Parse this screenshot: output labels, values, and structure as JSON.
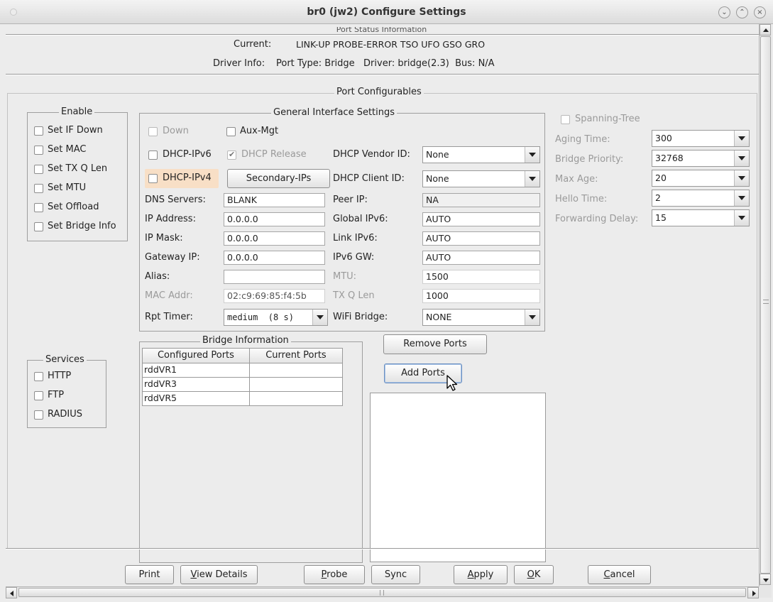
{
  "window": {
    "title": "br0  (jw2) Configure Settings"
  },
  "port_status": {
    "section_title": "Port Status Information",
    "current_label": "Current:",
    "current_value": "LINK-UP PROBE-ERROR TSO UFO GSO GRO",
    "driver_label": "Driver Info:",
    "driver_value": "Port Type: Bridge   Driver: bridge(2.3)  Bus: N/A"
  },
  "port_configurables": {
    "title": "Port Configurables"
  },
  "enable": {
    "title": "Enable",
    "items": [
      "Set IF Down",
      "Set MAC",
      "Set TX Q Len",
      "Set MTU",
      "Set Offload",
      "Set Bridge Info"
    ]
  },
  "services": {
    "title": "Services",
    "items": [
      "HTTP",
      "FTP",
      "RADIUS"
    ]
  },
  "general": {
    "title": "General Interface Settings",
    "down_label": "Down",
    "aux_mgt_label": "Aux-Mgt",
    "dhcp_ipv6_label": "DHCP-IPv6",
    "dhcp_release_label": "DHCP Release",
    "dhcp_vendor_label": "DHCP Vendor ID:",
    "dhcp_vendor_value": "None",
    "dhcp_ipv4_label": "DHCP-IPv4",
    "secondary_ips_label": "Secondary-IPs",
    "dhcp_client_label": "DHCP Client ID:",
    "dhcp_client_value": "None",
    "dns_label": "DNS Servers:",
    "dns_value": "BLANK",
    "peer_ip_label": "Peer IP:",
    "peer_ip_value": "NA",
    "ip_address_label": "IP Address:",
    "ip_address_value": "0.0.0.0",
    "global_ipv6_label": "Global IPv6:",
    "global_ipv6_value": "AUTO",
    "ip_mask_label": "IP Mask:",
    "ip_mask_value": "0.0.0.0",
    "link_ipv6_label": "Link IPv6:",
    "link_ipv6_value": "AUTO",
    "gateway_label": "Gateway IP:",
    "gateway_value": "0.0.0.0",
    "ipv6_gw_label": "IPv6 GW:",
    "ipv6_gw_value": "AUTO",
    "alias_label": "Alias:",
    "alias_value": "",
    "mtu_label": "MTU:",
    "mtu_value": "1500",
    "mac_label": "MAC Addr:",
    "mac_value": "02:c9:69:85:f4:5b",
    "txq_label": "TX Q Len",
    "txq_value": "1000",
    "rpt_timer_label": "Rpt Timer:",
    "rpt_timer_value": "medium  (8 s)",
    "wifi_bridge_label": "WiFi Bridge:",
    "wifi_bridge_value": "NONE"
  },
  "stp": {
    "spanning_tree_label": "Spanning-Tree",
    "aging_label": "Aging Time:",
    "aging_value": "300",
    "priority_label": "Bridge Priority:",
    "priority_value": "32768",
    "max_age_label": "Max Age:",
    "max_age_value": "20",
    "hello_label": "Hello Time:",
    "hello_value": "2",
    "fwd_delay_label": "Forwarding Delay:",
    "fwd_delay_value": "15"
  },
  "bridge": {
    "title": "Bridge Information",
    "columns": [
      "Configured Ports",
      "Current Ports"
    ],
    "rows": [
      [
        "rddVR1",
        ""
      ],
      [
        "rddVR3",
        ""
      ],
      [
        "rddVR5",
        ""
      ]
    ],
    "remove_label": "Remove Ports",
    "add_label": "Add Ports"
  },
  "buttons": {
    "print": "Print",
    "view_details_u": "V",
    "view_details_rest": "iew Details",
    "probe_u": "P",
    "probe_rest": "robe",
    "sync": "Sync",
    "apply_u": "A",
    "apply_rest": "pply",
    "ok_u": "O",
    "ok_rest": "K",
    "cancel_u": "C",
    "cancel_rest": "ancel"
  },
  "colors": {
    "window_bg": "#ececec",
    "highlight_dhcp_ipv4": "#f8dfc6",
    "selected_button_border": "#6a8fc0"
  }
}
